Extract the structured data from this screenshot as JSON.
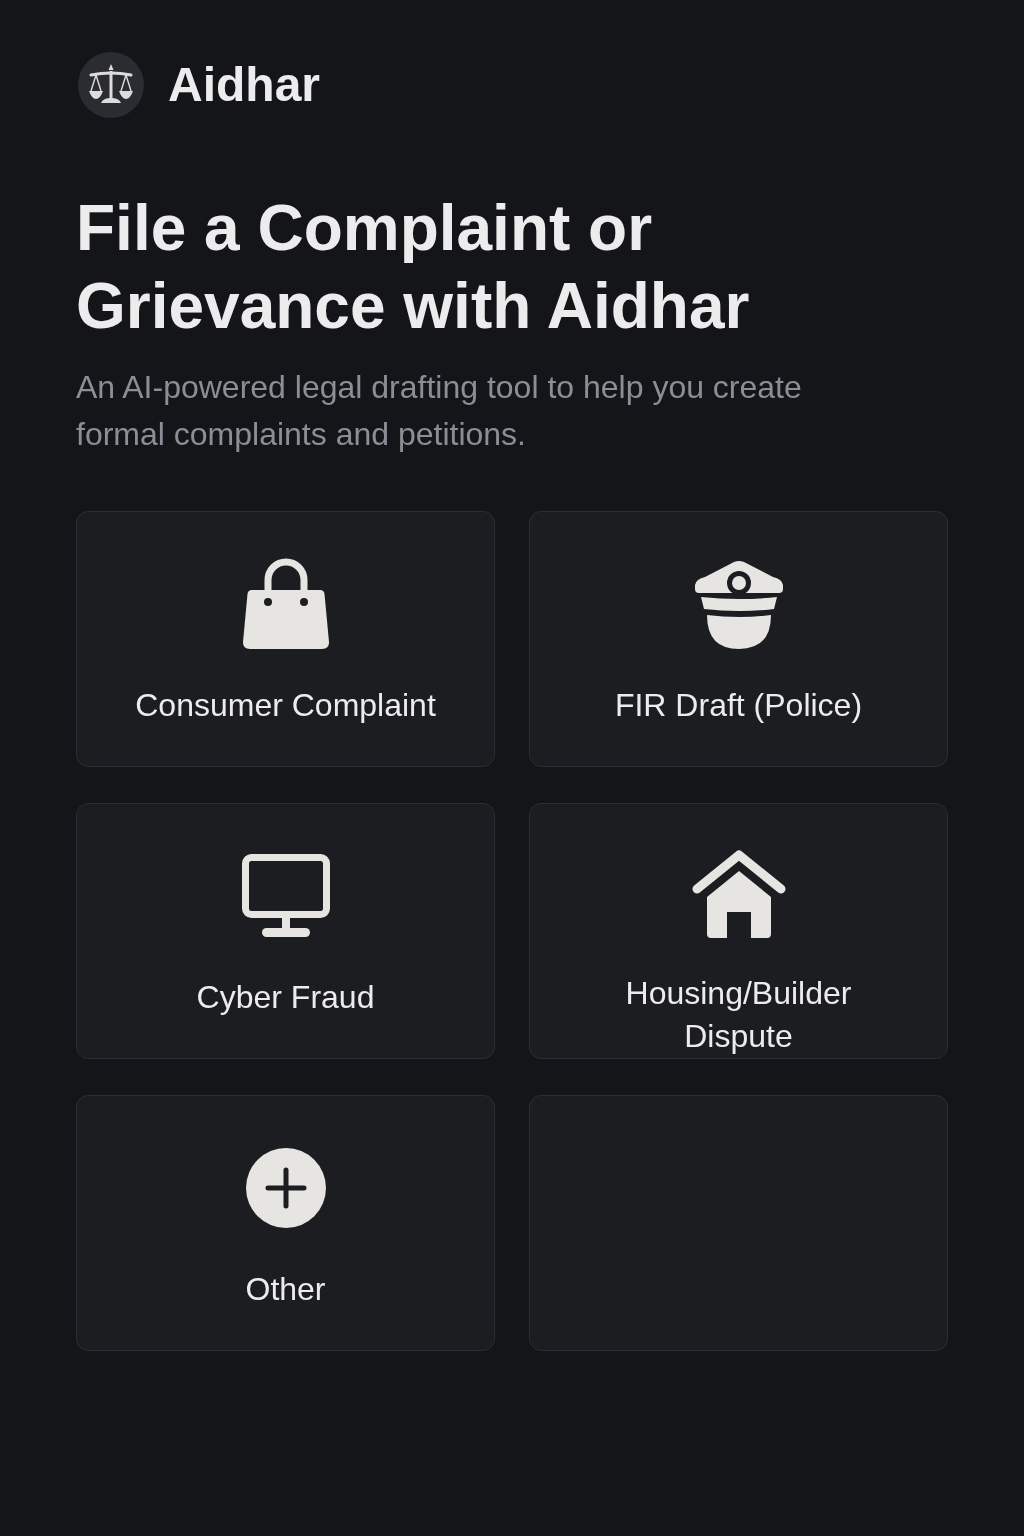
{
  "header": {
    "app_name": "Aidhar"
  },
  "title": "File a Complaint or Grievance with Aidhar",
  "subtitle": "An AI-powered legal drafting tool to help you create formal complaints and petitions.",
  "cards": [
    {
      "kind": "option",
      "label": "Consumer Complaint"
    },
    {
      "kind": "option",
      "label": "FIR Draft (Police)"
    },
    {
      "kind": "option",
      "label": "Cyber Fraud"
    },
    {
      "kind": "option",
      "label": "Housing/Builder Dispute"
    },
    {
      "kind": "option",
      "label": "Other"
    },
    {
      "kind": "blank"
    }
  ]
}
